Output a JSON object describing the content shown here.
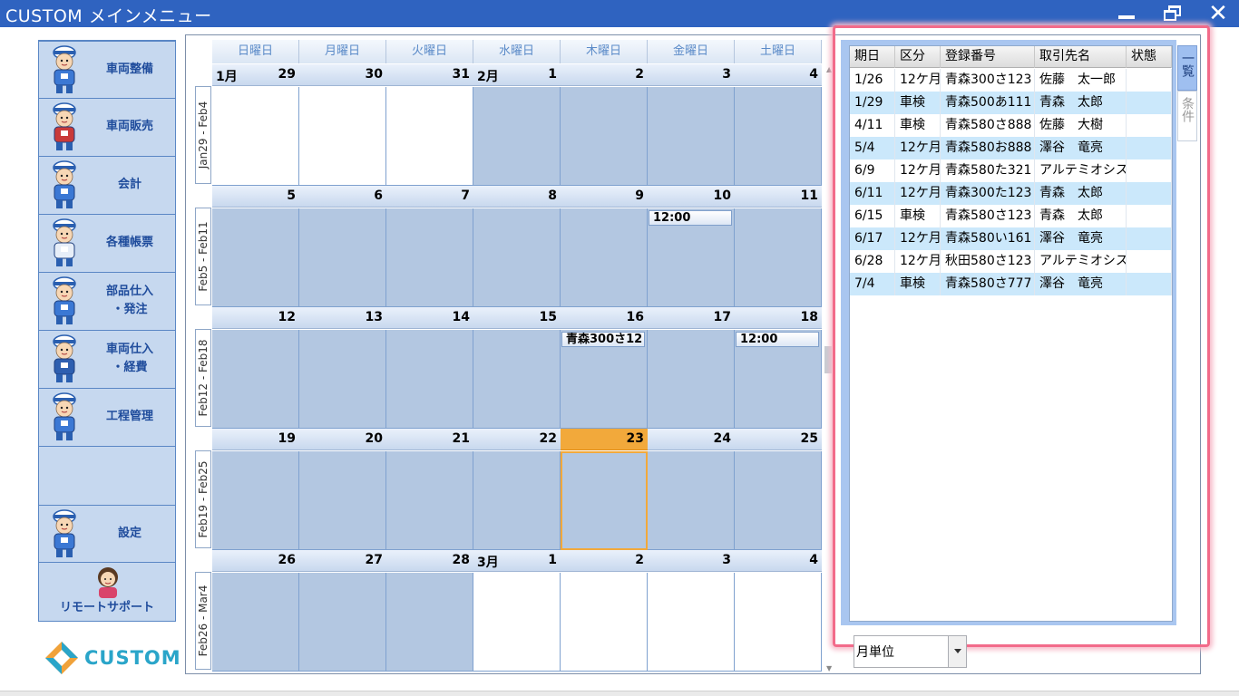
{
  "window": {
    "title": "CUSTOM メインメニュー"
  },
  "nav": {
    "items": [
      {
        "label": "車両整備",
        "icon": "mechanic-icon"
      },
      {
        "label": "車両販売",
        "icon": "car-sales-icon"
      },
      {
        "label": "会計",
        "icon": "accounting-icon"
      },
      {
        "label": "各種帳票",
        "icon": "forms-icon"
      },
      {
        "label_line1": "部品仕入",
        "label_line2": "・発注",
        "icon": "parts-icon"
      },
      {
        "label_line1": "車両仕入",
        "label_line2": "・経費",
        "icon": "vehicle-purchase-icon"
      },
      {
        "label": "工程管理",
        "icon": "process-icon"
      }
    ],
    "settings": {
      "label": "設定",
      "icon": "settings-person-icon"
    },
    "support": {
      "label": "リモートサポート",
      "icon": "support-woman-icon"
    }
  },
  "logo": {
    "text": "CUSTOM"
  },
  "calendar": {
    "weekdays": [
      "日曜日",
      "月曜日",
      "火曜日",
      "水曜日",
      "木曜日",
      "金曜日",
      "土曜日"
    ],
    "weeks": [
      {
        "label": "Jan29 - Feb4",
        "days": [
          {
            "num": "29",
            "month": "1月",
            "shade": "white"
          },
          {
            "num": "30",
            "shade": "white"
          },
          {
            "num": "31",
            "shade": "white"
          },
          {
            "num": "1",
            "month": "2月",
            "shade": "gray"
          },
          {
            "num": "2",
            "shade": "gray"
          },
          {
            "num": "3",
            "shade": "gray"
          },
          {
            "num": "4",
            "shade": "gray"
          }
        ]
      },
      {
        "label": "Feb5 - Feb11",
        "days": [
          {
            "num": "5",
            "shade": "gray"
          },
          {
            "num": "6",
            "shade": "gray"
          },
          {
            "num": "7",
            "shade": "gray"
          },
          {
            "num": "8",
            "shade": "gray"
          },
          {
            "num": "9",
            "shade": "gray"
          },
          {
            "num": "10",
            "shade": "gray",
            "appt": "12:00"
          },
          {
            "num": "11",
            "shade": "gray"
          }
        ]
      },
      {
        "label": "Feb12 - Feb18",
        "days": [
          {
            "num": "12",
            "shade": "gray"
          },
          {
            "num": "13",
            "shade": "gray"
          },
          {
            "num": "14",
            "shade": "gray"
          },
          {
            "num": "15",
            "shade": "gray"
          },
          {
            "num": "16",
            "shade": "gray",
            "appt": "青森300さ12"
          },
          {
            "num": "17",
            "shade": "gray"
          },
          {
            "num": "18",
            "shade": "gray",
            "appt": "12:00"
          }
        ]
      },
      {
        "label": "Feb19 - Feb25",
        "days": [
          {
            "num": "19",
            "shade": "gray"
          },
          {
            "num": "20",
            "shade": "gray"
          },
          {
            "num": "21",
            "shade": "gray"
          },
          {
            "num": "22",
            "shade": "gray"
          },
          {
            "num": "23",
            "shade": "gray",
            "today": true
          },
          {
            "num": "24",
            "shade": "gray"
          },
          {
            "num": "25",
            "shade": "gray"
          }
        ]
      },
      {
        "label": "Feb26 - Mar4",
        "days": [
          {
            "num": "26",
            "shade": "gray"
          },
          {
            "num": "27",
            "shade": "gray"
          },
          {
            "num": "28",
            "shade": "gray"
          },
          {
            "num": "1",
            "month": "3月",
            "shade": "white"
          },
          {
            "num": "2",
            "shade": "white"
          },
          {
            "num": "3",
            "shade": "white"
          },
          {
            "num": "4",
            "shade": "white"
          }
        ]
      }
    ]
  },
  "list": {
    "columns": [
      "期日",
      "区分",
      "登録番号",
      "取引先名",
      "状態"
    ],
    "rows": [
      [
        "1/26",
        "12ケ月",
        "青森300さ123",
        "佐藤　太一郎",
        ""
      ],
      [
        "1/29",
        "車検",
        "青森500あ111",
        "青森　太郎",
        ""
      ],
      [
        "4/11",
        "車検",
        "青森580さ888",
        "佐藤　大樹",
        ""
      ],
      [
        "5/4",
        "12ケ月",
        "青森580お888",
        "澤谷　竜亮",
        ""
      ],
      [
        "6/9",
        "12ケ月",
        "青森580た321",
        "アルテミオシス",
        ""
      ],
      [
        "6/11",
        "12ケ月",
        "青森300た123",
        "青森　太郎",
        ""
      ],
      [
        "6/15",
        "車検",
        "青森580さ123",
        "青森　太郎",
        ""
      ],
      [
        "6/17",
        "12ケ月",
        "青森580い161",
        "澤谷　竜亮",
        ""
      ],
      [
        "6/28",
        "12ケ月",
        "秋田580さ123",
        "アルテミオシス",
        ""
      ],
      [
        "7/4",
        "車検",
        "青森580さ777",
        "澤谷　竜亮",
        ""
      ]
    ],
    "tabs": [
      "一覧",
      "条件"
    ],
    "view_select": {
      "value": "月単位"
    }
  },
  "colors": {
    "titlebar": "#2f63c0",
    "today": "#f2a93b",
    "highlight": "#f26b8a"
  }
}
